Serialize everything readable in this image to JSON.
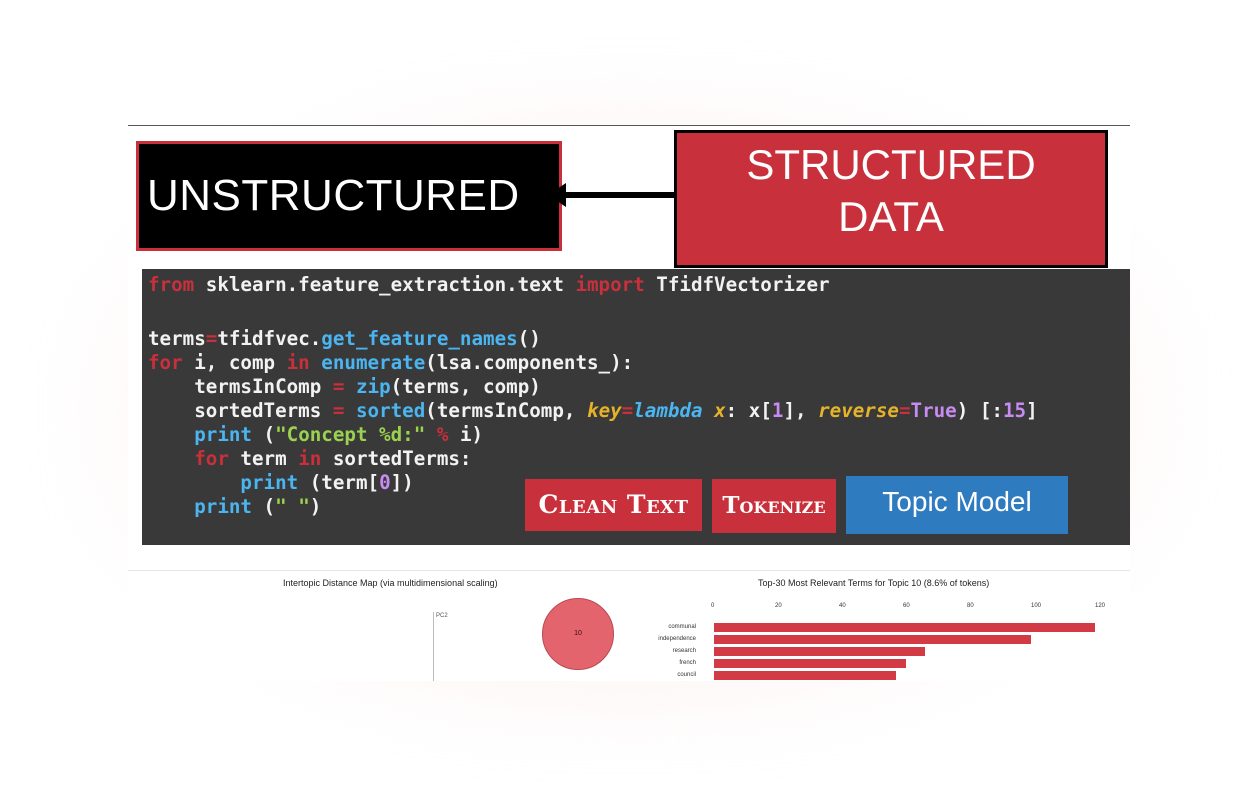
{
  "diagram": {
    "left_box": "UNSTRUCTURED",
    "right_box_line1": "STRUCTURED",
    "right_box_line2": "DATA"
  },
  "code": {
    "line1": {
      "kw1": "from",
      "mod": " sklearn.feature_extraction.text ",
      "kw2": "import",
      "cls": " TfidfVectorizer"
    },
    "line3": {
      "a": "terms",
      "eq": "=",
      "b": "tfidfvec.",
      "fn": "get_feature_names",
      "c": "()"
    },
    "line4": {
      "kw": "for",
      "a": " i, comp ",
      "kw2": "in",
      "sp": " ",
      "fn": "enumerate",
      "c": "(lsa.components_):"
    },
    "line5": {
      "ind": "    termsInComp ",
      "eq": "=",
      "sp": " ",
      "fn": "zip",
      "c": "(terms, comp)"
    },
    "line6": {
      "ind": "    sortedTerms ",
      "eq": "=",
      "sp": " ",
      "fn": "sorted",
      "c": "(termsInComp, ",
      "k": "key",
      "eq2": "=",
      "lam": "lambda",
      "x": " x",
      "col": ": x[",
      "n1": "1",
      "c2": "], ",
      "r": "reverse",
      "eq3": "=",
      "t": "True",
      "c3": ") [:",
      "n15": "15",
      "c4": "]"
    },
    "line7": {
      "ind": "    ",
      "fn": "print",
      "a": " (",
      "s": "\"Concept %d:\"",
      "sp": " ",
      "op": "%",
      "b": " i)"
    },
    "line8": {
      "ind": "    ",
      "kw": "for",
      "a": " term ",
      "kw2": "in",
      "b": " sortedTerms:"
    },
    "line9": {
      "ind": "        ",
      "fn": "print",
      "a": " (term[",
      "n": "0",
      "b": "])"
    },
    "line10": {
      "ind": "    ",
      "fn": "print",
      "a": " (",
      "s": "\" \"",
      "b": ")"
    }
  },
  "buttons": {
    "clean_text": "Clean Text",
    "tokenize": "Tokenize",
    "topic_model": "Topic Model"
  },
  "viz": {
    "left_title": "Intertopic Distance Map (via multidimensional scaling)",
    "pc_label": "PC2",
    "bubble_label": "10",
    "right_title": "Top-30 Most Relevant Terms for Topic 10 (8.6% of tokens)",
    "ticks": [
      "0",
      "20",
      "40",
      "60",
      "80",
      "100",
      "120"
    ],
    "bars": [
      {
        "term": "communal",
        "value": 119
      },
      {
        "term": "independence",
        "value": 99
      },
      {
        "term": "research",
        "value": 66
      },
      {
        "term": "french",
        "value": 60
      },
      {
        "term": "council",
        "value": 57
      }
    ],
    "bar_color": "#d23a46"
  },
  "colors": {
    "accent_red": "#c8303c",
    "topic_blue": "#2f7bc0",
    "code_bg": "#393939"
  }
}
